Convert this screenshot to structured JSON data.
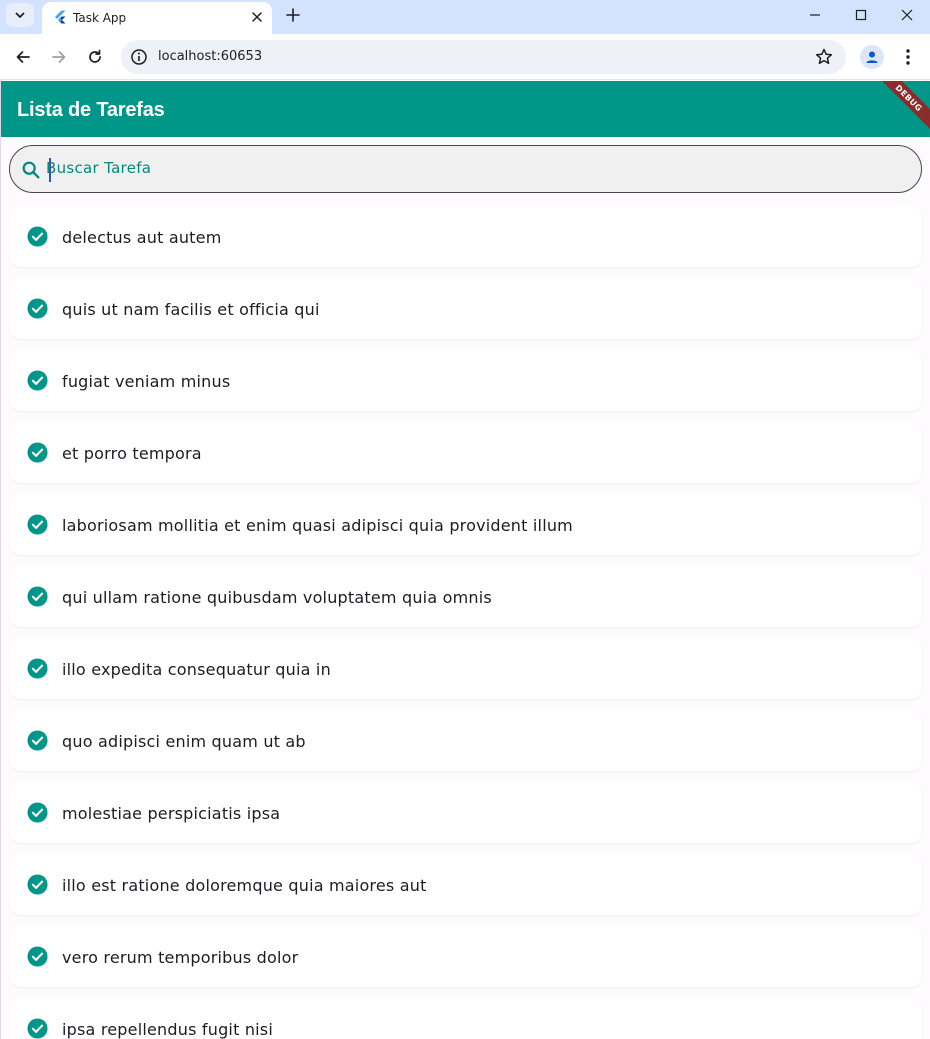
{
  "browser": {
    "tab_title": "Task App",
    "url": "localhost:60653",
    "tab_favicon": "flutter-icon"
  },
  "app": {
    "title": "Lista de Tarefas",
    "debug_banner": "DEBUG",
    "colors": {
      "primary": "#009688",
      "accent_text": "#00897b",
      "check": "#009688"
    },
    "search": {
      "placeholder": "Buscar Tarefa",
      "value": "",
      "icon": "search-icon"
    },
    "tasks": [
      {
        "title": "delectus aut autem",
        "completed": true
      },
      {
        "title": "quis ut nam facilis et officia qui",
        "completed": true
      },
      {
        "title": "fugiat veniam minus",
        "completed": true
      },
      {
        "title": "et porro tempora",
        "completed": true
      },
      {
        "title": "laboriosam mollitia et enim quasi adipisci quia provident illum",
        "completed": true
      },
      {
        "title": "qui ullam ratione quibusdam voluptatem quia omnis",
        "completed": true
      },
      {
        "title": "illo expedita consequatur quia in",
        "completed": true
      },
      {
        "title": "quo adipisci enim quam ut ab",
        "completed": true
      },
      {
        "title": "molestiae perspiciatis ipsa",
        "completed": true
      },
      {
        "title": "illo est ratione doloremque quia maiores aut",
        "completed": true
      },
      {
        "title": "vero rerum temporibus dolor",
        "completed": true
      },
      {
        "title": "ipsa repellendus fugit nisi",
        "completed": true
      }
    ]
  }
}
